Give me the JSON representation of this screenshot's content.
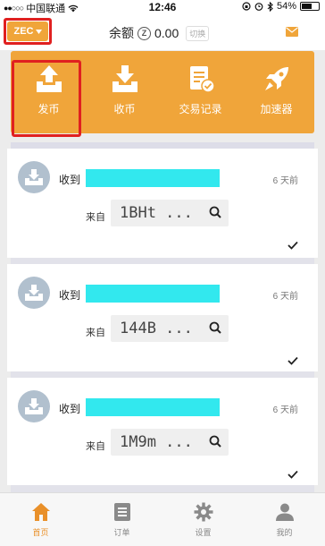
{
  "status_bar": {
    "carrier": "中国联通",
    "time": "12:46",
    "battery": "54%"
  },
  "header": {
    "coin_selector": "ZEC",
    "balance_label": "余额",
    "balance_symbol": "Z",
    "balance_value": "0.00",
    "switch_label": "切换",
    "mail_icon": "mail-icon"
  },
  "actions": [
    {
      "label": "发币",
      "icon": "upload-tray-icon"
    },
    {
      "label": "收币",
      "icon": "download-tray-icon"
    },
    {
      "label": "交易记录",
      "icon": "transaction-record-icon"
    },
    {
      "label": "加速器",
      "icon": "rocket-icon"
    }
  ],
  "transactions": [
    {
      "type_label": "收到",
      "time": "6 天前",
      "from_label": "来自",
      "from_addr": "1BHt ...",
      "status_icon": "check-icon"
    },
    {
      "type_label": "收到",
      "time": "6 天前",
      "from_label": "来自",
      "from_addr": "144B ...",
      "status_icon": "check-icon"
    },
    {
      "type_label": "收到",
      "time": "6 天前",
      "from_label": "来自",
      "from_addr": "1M9m ...",
      "status_icon": "check-icon"
    }
  ],
  "tabs": [
    {
      "label": "首页",
      "icon": "home-icon",
      "active": true
    },
    {
      "label": "订单",
      "icon": "order-list-icon",
      "active": false
    },
    {
      "label": "设置",
      "icon": "gear-icon",
      "active": false
    },
    {
      "label": "我的",
      "icon": "user-icon",
      "active": false
    }
  ],
  "colors": {
    "accent": "#f0a53a",
    "highlight_border": "#e02020",
    "masked_address": "#32e8ee",
    "tab_active": "#e9902a"
  }
}
